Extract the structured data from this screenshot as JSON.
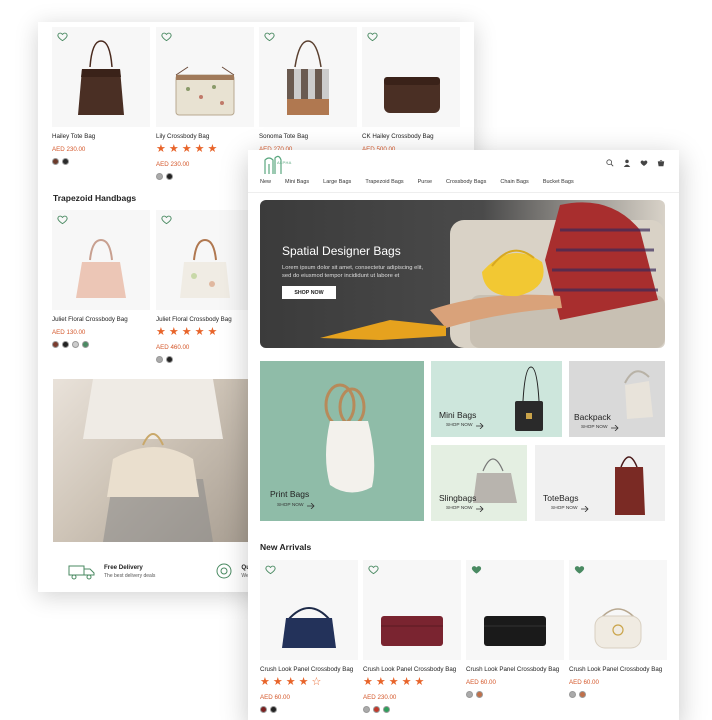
{
  "back": {
    "top_products": [
      {
        "name": "Hailey Tote Bag",
        "price": "AED 230.00",
        "stars": 0,
        "swatches": [
          "#6b3a2a",
          "#2a2a2a"
        ]
      },
      {
        "name": "Lily Crossbody Bag",
        "price": "AED 230.00",
        "stars": 5,
        "swatches": [
          "#aaaaaa",
          "#222222"
        ]
      },
      {
        "name": "Sonoma Tote Bag",
        "price": "AED 270.00",
        "stars": 0,
        "swatches": []
      },
      {
        "name": "CK Hailey Crossbody Bag",
        "price": "AED 500.00",
        "stars": 0,
        "swatches": []
      }
    ],
    "section_title": "Trapezoid Handbags",
    "trapezoid_products": [
      {
        "name": "Juliet Floral Crossbody Bag",
        "price": "AED 130.00",
        "stars": 0,
        "swatches": [
          "#7a3b2e",
          "#222222",
          "#cccccc",
          "#4a8a62"
        ]
      },
      {
        "name": "Juliet Floral Crossbody Bag",
        "price": "AED 460.00",
        "stars": 5,
        "swatches": [
          "#aaaaaa",
          "#222222"
        ]
      }
    ],
    "features": [
      {
        "title": "Free Delivery",
        "subtitle": "The best delivery deals"
      },
      {
        "title": "Qua",
        "subtitle": "We e"
      }
    ]
  },
  "front": {
    "logo_text": "ALPHA",
    "nav": [
      "New",
      "Mini Bags",
      "Large Bags",
      "Trapezoid Bags",
      "Purse",
      "Crossbody Bags",
      "Chain Bags",
      "Bucket Bags"
    ],
    "hero": {
      "title": "Spatial Designer Bags",
      "text": "Lorem ipsum dolor sit amet, consectetur adipiscing elit, sed do eiusmod tempor incididunt ut labore et",
      "button": "SHOP NOW"
    },
    "categories": [
      {
        "label": "Print Bags",
        "shop": "SHOP NOW"
      },
      {
        "label": "Mini Bags",
        "shop": "SHOP NOW"
      },
      {
        "label": "Backpack",
        "shop": "SHOP NOW"
      },
      {
        "label": "Slingbags",
        "shop": "SHOP NOW"
      },
      {
        "label": "ToteBags",
        "shop": "SHOP NOW"
      }
    ],
    "arrivals_title": "New Arrivals",
    "arrivals": [
      {
        "name": "Crush Look Panel Crossbody Bag",
        "price": "AED 60.00",
        "stars": 4,
        "swatches": [
          "#7a2020",
          "#222222"
        ]
      },
      {
        "name": "Crush Look Panel Crossbody Bag",
        "price": "AED 230.00",
        "stars": 5,
        "swatches": [
          "#aaaaaa",
          "#c0392b",
          "#2e9e5b"
        ]
      },
      {
        "name": "Crush Look Panel Crossbody Bag",
        "price": "AED 60.00",
        "stars": 0,
        "swatches": [
          "#aaaaaa",
          "#c0704a"
        ]
      },
      {
        "name": "Crush Look Panel Crossbody Bag",
        "price": "AED 60.00",
        "stars": 0,
        "swatches": [
          "#aaaaaa",
          "#c0704a"
        ]
      }
    ]
  },
  "colors": {
    "accent": "#e8642a",
    "price": "#d4572a",
    "brand_green": "#5aa77f"
  },
  "icons": [
    "heart-icon",
    "search-icon",
    "user-icon",
    "cart-icon",
    "truck-icon",
    "quality-badge-icon",
    "arrow-right-icon"
  ]
}
